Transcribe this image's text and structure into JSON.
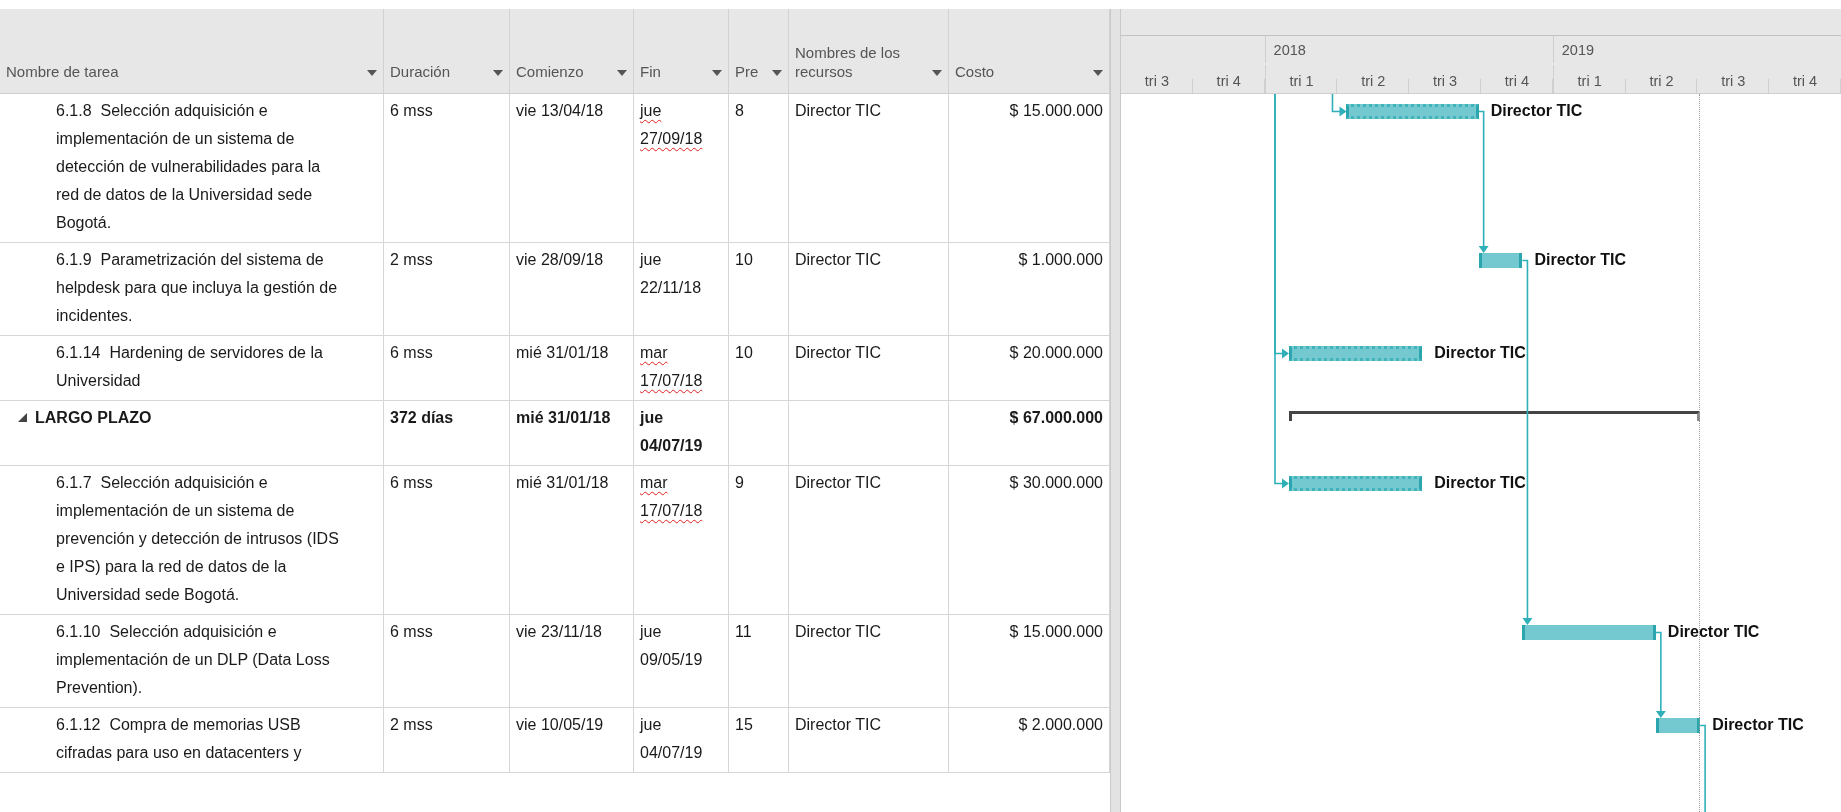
{
  "table": {
    "columns": [
      {
        "label": "Nombre de tarea"
      },
      {
        "label": "Duración"
      },
      {
        "label": "Comienzo"
      },
      {
        "label": "Fin"
      },
      {
        "label": "Pre"
      },
      {
        "label": "Nombres de los recursos"
      },
      {
        "label": "Costo"
      }
    ],
    "rows": [
      {
        "kind": "task",
        "name": "6.1.8  Selección adquisición e implementación de un sistema de detección de vulnerabilidades para la red de datos de la Universidad sede Bogotá.",
        "duration": "6 mss",
        "start": "vie 13/04/18",
        "finish": "jue 27/09/18",
        "finish_flagged": true,
        "predecessors": "8",
        "resources": "Director TIC",
        "cost": "$ 15.000.000",
        "bar": {
          "kind": "hatched",
          "label": "Director TIC"
        }
      },
      {
        "kind": "task",
        "name": "6.1.9  Parametrización del sistema de helpdesk para que incluya la gestión de incidentes.",
        "duration": "2 mss",
        "start": "vie 28/09/18",
        "finish": "jue 22/11/18",
        "finish_flagged": false,
        "predecessors": "10",
        "resources": "Director TIC",
        "cost": "$ 1.000.000",
        "bar": {
          "kind": "solid",
          "label": "Director TIC"
        }
      },
      {
        "kind": "task",
        "name": "6.1.14  Hardening de servidores de la Universidad",
        "duration": "6 mss",
        "start": "mié 31/01/18",
        "finish": "mar 17/07/18",
        "finish_flagged": true,
        "predecessors": "10",
        "resources": "Director TIC",
        "cost": "$ 20.000.000",
        "bar": {
          "kind": "hatched",
          "label": "Director TIC"
        }
      },
      {
        "kind": "summary",
        "expanded": true,
        "name": "LARGO PLAZO",
        "duration": "372 días",
        "start": "mié 31/01/18",
        "finish": "jue 04/07/19",
        "finish_flagged": false,
        "cost": "$ 67.000.000",
        "bar": {
          "kind": "summary"
        }
      },
      {
        "kind": "task",
        "name": "6.1.7  Selección adquisición e implementación de un sistema de prevención y detección de intrusos (IDS e IPS) para la red de datos de la Universidad sede Bogotá.",
        "duration": "6 mss",
        "start": "mié 31/01/18",
        "finish": "mar 17/07/18",
        "finish_flagged": true,
        "predecessors": "9",
        "resources": "Director TIC",
        "cost": "$ 30.000.000",
        "bar": {
          "kind": "hatched",
          "label": "Director TIC"
        }
      },
      {
        "kind": "task",
        "name": "6.1.10  Selección adquisición e implementación de un DLP (Data Loss Prevention).",
        "duration": "6 mss",
        "start": "vie 23/11/18",
        "finish": "jue 09/05/19",
        "finish_flagged": false,
        "predecessors": "11",
        "resources": "Director TIC",
        "cost": "$ 15.000.000",
        "bar": {
          "kind": "solid",
          "label": "Director TIC"
        }
      },
      {
        "kind": "task",
        "name": "6.1.12  Compra de memorias USB cifradas para uso en datacenters y",
        "duration": "2 mss",
        "start": "vie 10/05/19",
        "finish": "jue 04/07/19",
        "finish_flagged": false,
        "predecessors": "15",
        "resources": "Director TIC",
        "cost": "$ 2.000.000",
        "bar": {
          "kind": "solid",
          "label": "Director TIC"
        }
      }
    ]
  },
  "timescale": {
    "quarters": [
      {
        "label": "tri 3"
      },
      {
        "label": "tri 4"
      },
      {
        "label": "tri 1",
        "year": "2018"
      },
      {
        "label": "tri 2"
      },
      {
        "label": "tri 3"
      },
      {
        "label": "tri 4"
      },
      {
        "label": "tri 1",
        "year": "2019"
      },
      {
        "label": "tri 2"
      },
      {
        "label": "tri 3"
      },
      {
        "label": "tri 4"
      }
    ]
  },
  "gantt": {
    "finish_marker": true
  }
}
